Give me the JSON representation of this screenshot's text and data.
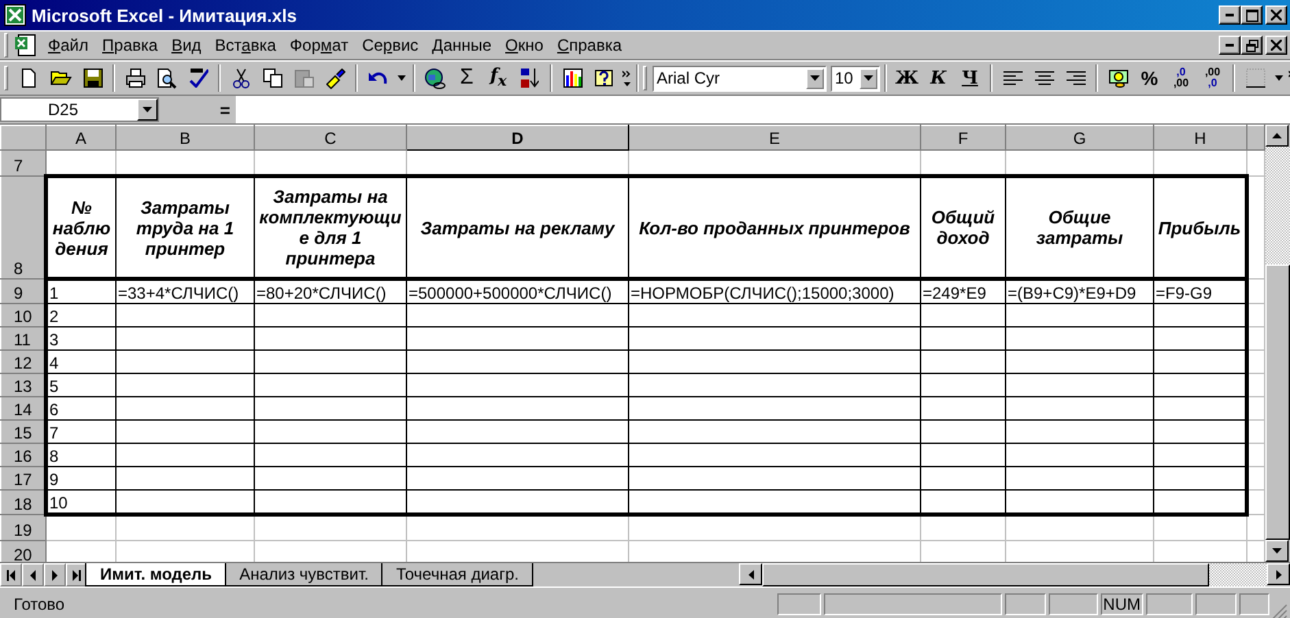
{
  "window": {
    "title": "Microsoft Excel - Имитация.xls"
  },
  "menu": [
    {
      "key": "Ф",
      "rest": "айл"
    },
    {
      "key": "П",
      "rest": "равка"
    },
    {
      "key": "В",
      "rest": "ид"
    },
    {
      "pre": "Вст",
      "key": "а",
      "rest": "вка"
    },
    {
      "pre": "Фор",
      "key": "м",
      "rest": "ат"
    },
    {
      "pre": "Се",
      "key": "р",
      "rest": "вис"
    },
    {
      "key": "Д",
      "rest": "анные"
    },
    {
      "key": "О",
      "rest": "кно"
    },
    {
      "key": "С",
      "rest": "правка"
    }
  ],
  "toolbar": {
    "sum": "Σ",
    "function": "f$_{x}$",
    "font": {
      "name": "Arial Cyr",
      "size": "10"
    },
    "format_buttons": [
      {
        "label": "Ж",
        "kind": "bold"
      },
      {
        "label": "К",
        "kind": "italic"
      },
      {
        "label": "Ч",
        "kind": "underline"
      }
    ],
    "percent": "%",
    "decimal_buttons": [
      {
        "kind": "increase",
        "top": ",0",
        "bottom": ",00"
      },
      {
        "kind": "decrease",
        "top": ",00",
        "bottom": ",0"
      }
    ]
  },
  "formula_bar": {
    "name_box": "D25",
    "equals": "="
  },
  "sheet": {
    "columns": [
      {
        "letter": "A",
        "selected": false
      },
      {
        "letter": "B",
        "selected": false
      },
      {
        "letter": "C",
        "selected": false
      },
      {
        "letter": "D",
        "selected": true
      },
      {
        "letter": "E",
        "selected": false
      },
      {
        "letter": "F",
        "selected": false
      },
      {
        "letter": "G",
        "selected": false
      },
      {
        "letter": "H",
        "selected": false
      }
    ],
    "rows": [
      {
        "number": "7",
        "kind": "blank"
      },
      {
        "number": "8",
        "kind": "header",
        "cells": [
          "№ наблюдения",
          "Затраты труда на 1 принтер",
          "Затраты на комплектующие для 1 принтера",
          "Затраты на рекламу",
          "Кол-во проданных принтеров",
          "Общий доход",
          "Общие затраты",
          "Прибыль"
        ]
      },
      {
        "number": "9",
        "kind": "data",
        "cells": [
          "1",
          "=33+4*СЛЧИС()",
          "=80+20*СЛЧИС()",
          "=500000+500000*СЛЧИС()",
          "=НОРМОБР(СЛЧИС();15000;3000)",
          "=249*E9",
          "=(B9+C9)*E9+D9",
          "=F9-G9"
        ]
      },
      {
        "number": "10",
        "kind": "data",
        "cells": [
          "2"
        ]
      },
      {
        "number": "11",
        "kind": "data",
        "cells": [
          "3"
        ]
      },
      {
        "number": "12",
        "kind": "data",
        "cells": [
          "4"
        ]
      },
      {
        "number": "13",
        "kind": "data",
        "cells": [
          "5"
        ]
      },
      {
        "number": "14",
        "kind": "data",
        "cells": [
          "6"
        ]
      },
      {
        "number": "15",
        "kind": "data",
        "cells": [
          "7"
        ]
      },
      {
        "number": "16",
        "kind": "data",
        "cells": [
          "8"
        ]
      },
      {
        "number": "17",
        "kind": "data",
        "cells": [
          "9"
        ]
      },
      {
        "number": "18",
        "kind": "data",
        "cells": [
          "10"
        ]
      },
      {
        "number": "19",
        "kind": "blank"
      },
      {
        "number": "20",
        "kind": "blank"
      }
    ]
  },
  "sheet_tabs": [
    {
      "label": "Имит. модель",
      "selected": true
    },
    {
      "label": "Анализ чувствит.",
      "selected": false
    },
    {
      "label": "Точечная диагр.",
      "selected": false
    }
  ],
  "status_bar": {
    "text": "Готово",
    "num": "NUM"
  }
}
